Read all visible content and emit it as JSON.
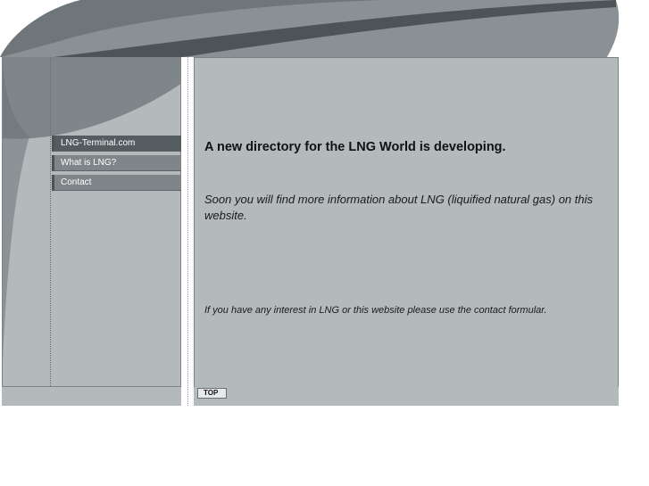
{
  "colors": {
    "panel_background": "#b4b9bc",
    "header_dark": "#4d5458",
    "header_mid": "#7f868a",
    "nav_active": "#555c60",
    "nav_item": "#7f8589",
    "nav_text": "#ffffff"
  },
  "nav": {
    "items": [
      {
        "label": "LNG-Terminal.com",
        "active": true
      },
      {
        "label": "What is LNG?",
        "active": false
      },
      {
        "label": "Contact",
        "active": false
      }
    ]
  },
  "main": {
    "headline": "A new directory for the LNG World is developing.",
    "intro": "Soon you will find more information about LNG (liquified natural gas) on this website.",
    "contact_note": "If you have any interest in LNG or this website please use the contact formular."
  },
  "footer": {
    "top_label": "TOP"
  }
}
